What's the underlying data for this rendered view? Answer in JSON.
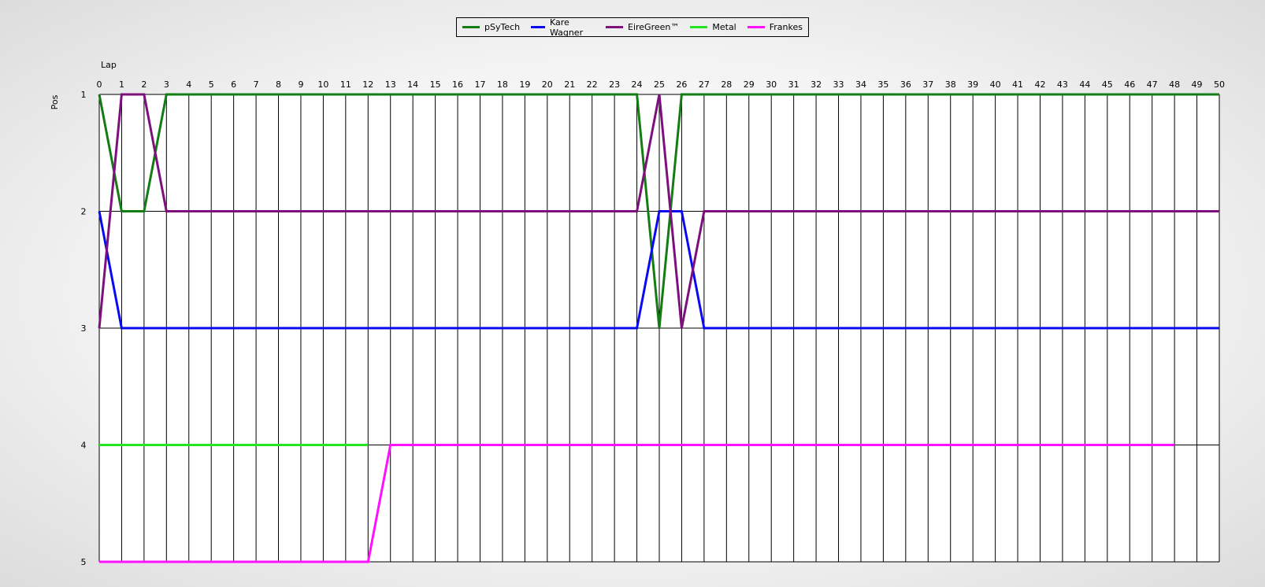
{
  "chart_data": {
    "type": "line",
    "xlabel": "Lap",
    "ylabel": "Pos",
    "xlim": [
      0,
      50
    ],
    "ylim": [
      1,
      5
    ],
    "y_inverted": true,
    "x_ticks": [
      0,
      1,
      2,
      3,
      4,
      5,
      6,
      7,
      8,
      9,
      10,
      11,
      12,
      13,
      14,
      15,
      16,
      17,
      18,
      19,
      20,
      21,
      22,
      23,
      24,
      25,
      26,
      27,
      28,
      29,
      30,
      31,
      32,
      33,
      34,
      35,
      36,
      37,
      38,
      39,
      40,
      41,
      42,
      43,
      44,
      45,
      46,
      47,
      48,
      49,
      50
    ],
    "y_ticks": [
      1,
      2,
      3,
      4,
      5
    ],
    "grid": true,
    "x_axis_position": "top",
    "legend_position": "top-center",
    "series": [
      {
        "name": "pSyTech",
        "color": "#137d13",
        "points": [
          [
            0,
            1
          ],
          [
            1,
            2
          ],
          [
            2,
            2
          ],
          [
            3,
            1
          ],
          [
            24,
            1
          ],
          [
            25,
            3
          ],
          [
            26,
            1
          ],
          [
            50,
            1
          ]
        ]
      },
      {
        "name": "Kare Wagner",
        "color": "#0a0af0",
        "points": [
          [
            0,
            2
          ],
          [
            1,
            3
          ],
          [
            24,
            3
          ],
          [
            25,
            2
          ],
          [
            26,
            2
          ],
          [
            27,
            3
          ],
          [
            50,
            3
          ]
        ]
      },
      {
        "name": "EireGreen™",
        "color": "#7d107d",
        "points": [
          [
            0,
            3
          ],
          [
            1,
            1
          ],
          [
            2,
            1
          ],
          [
            3,
            2
          ],
          [
            24,
            2
          ],
          [
            25,
            1
          ],
          [
            26,
            3
          ],
          [
            27,
            2
          ],
          [
            50,
            2
          ]
        ]
      },
      {
        "name": "Metal",
        "color": "#22e622",
        "points": [
          [
            0,
            4
          ],
          [
            12,
            4
          ]
        ]
      },
      {
        "name": "Frankes",
        "color": "#ff10ff",
        "points": [
          [
            0,
            5
          ],
          [
            12,
            5
          ],
          [
            13,
            4
          ],
          [
            48,
            4
          ]
        ]
      }
    ]
  }
}
